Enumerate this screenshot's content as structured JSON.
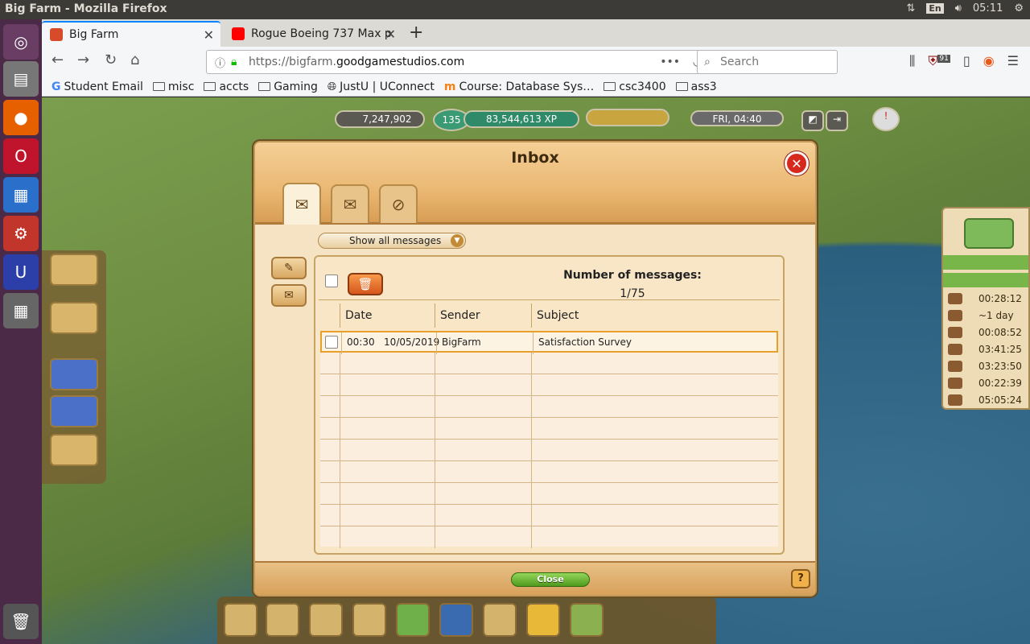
{
  "os": {
    "window_title": "Big Farm - Mozilla Firefox",
    "keyboard_lang": "En",
    "clock": "05:11"
  },
  "browser": {
    "tabs": [
      {
        "label": "Big Farm",
        "active": true
      },
      {
        "label": "Rogue Boeing 737 Max p",
        "active": false
      }
    ],
    "url_prefix": "https://bigfarm.",
    "url_domain": "goodgamestudios.com",
    "search_placeholder": "Search",
    "ublock_badge": "91",
    "bookmarks": [
      "Student Email",
      "misc",
      "accts",
      "Gaming",
      "JustU | UConnect",
      "Course: Database Sys…",
      "csc3400",
      "ass3"
    ]
  },
  "game": {
    "coins": "7,247,902",
    "level": "135",
    "xp": "83,544,613 XP",
    "clock": "FRI, 04:40",
    "timers": [
      "00:28:12",
      "~1 day",
      "00:08:52",
      "03:41:25",
      "03:23:50",
      "00:22:39",
      "05:05:24"
    ]
  },
  "inbox": {
    "title": "Inbox",
    "filter": "Show all messages",
    "count_label": "Number of messages:",
    "count_value": "1/75",
    "columns": {
      "date": "Date",
      "sender": "Sender",
      "subject": "Subject"
    },
    "messages": [
      {
        "time": "00:30",
        "date": "10/05/2019",
        "sender": "BigFarm",
        "subject": "Satisfaction Survey"
      }
    ],
    "close_label": "Close",
    "help_label": "?"
  }
}
